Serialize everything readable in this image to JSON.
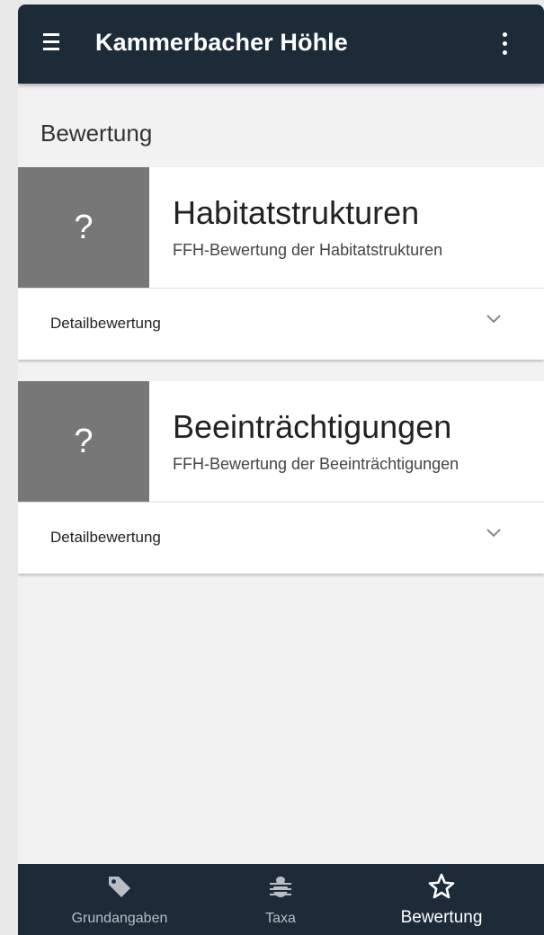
{
  "appbar": {
    "title": "Kammerbacher Höhle",
    "menu_icon": "hamburger-menu-icon",
    "more_icon": "more-vertical-icon"
  },
  "section": {
    "title": "Bewertung"
  },
  "cards": [
    {
      "score": "?",
      "title": "Habitatstrukturen",
      "subtitle": "FFH-Bewertung der Habitatstrukturen",
      "expander_label": "Detailbewertung",
      "expander_icon": "chevron-down-icon",
      "expanded": false
    },
    {
      "score": "?",
      "title": "Beeinträchtigungen",
      "subtitle": "FFH-Bewertung der Beeinträchtigungen",
      "expander_label": "Detailbewertung",
      "expander_icon": "chevron-down-icon",
      "expanded": false
    }
  ],
  "bottom_nav": {
    "items": [
      {
        "label": "Grundangaben",
        "icon": "tag-icon",
        "active": false
      },
      {
        "label": "Taxa",
        "icon": "bug-icon",
        "active": false
      },
      {
        "label": "Bewertung",
        "icon": "star-outline-icon",
        "active": true
      }
    ]
  },
  "colors": {
    "appbar_bg": "#1d2b39",
    "score_box_bg": "#777777",
    "page_bg": "#f2f2f2",
    "nav_active": "#ffffff",
    "nav_inactive": "#b8bec4"
  }
}
